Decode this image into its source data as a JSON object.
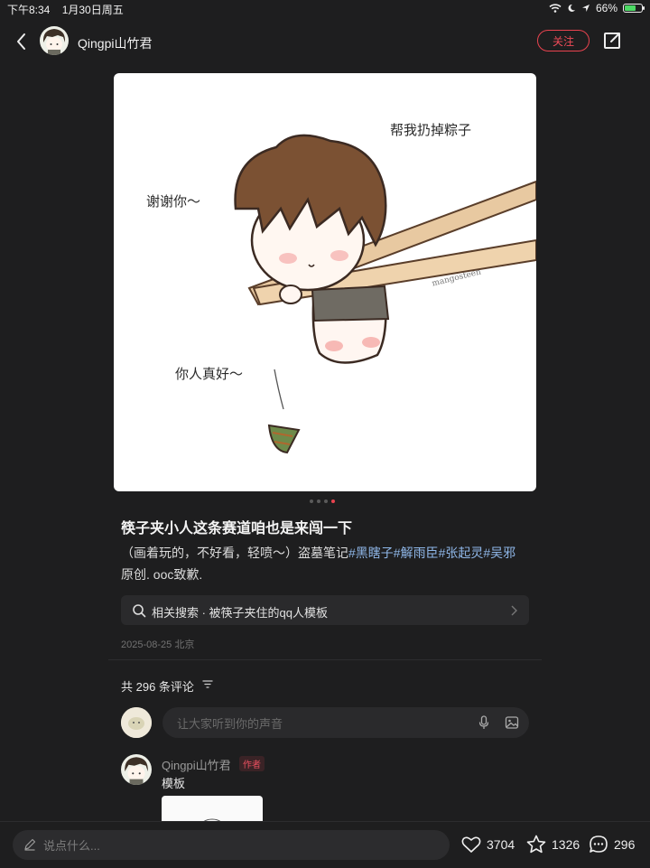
{
  "status_bar": {
    "time": "下午8:34",
    "date": "1月30日周五",
    "battery": "66%",
    "battery_level": 0.66
  },
  "header": {
    "author_name": "Qingpi山竹君",
    "follow_label": "关注"
  },
  "image": {
    "captions": [
      "帮我扔掉粽子",
      "谢谢你～",
      "你人真好～"
    ],
    "signature": "mangosteen",
    "page_count": 4,
    "current_page": 4
  },
  "post": {
    "title": "筷子夹小人这条赛道咱也是来闯一下",
    "desc_prefix": "（画着玩的，不好看，轻喷～）盗墓笔记",
    "tags": [
      "#黑瞎子",
      "#解雨臣",
      "#张起灵",
      "#吴邪"
    ],
    "desc_suffix": "  原创. ooc致歉.",
    "related_search": "相关搜索 · 被筷子夹住的qq人模板",
    "date_location": "2025-08-25 北京"
  },
  "comments": {
    "count_label": "共 296 条评论",
    "input_placeholder": "让大家听到你的声音",
    "items": [
      {
        "name": "Qingpi山竹君",
        "badge": "作者",
        "text": "模板"
      }
    ]
  },
  "bottom_bar": {
    "input_placeholder": "说点什么...",
    "likes": "3704",
    "favorites": "1326",
    "comments": "296"
  },
  "colors": {
    "accent": "#e9434f",
    "tag": "#8fb7e8",
    "background": "#1e1e1f"
  }
}
